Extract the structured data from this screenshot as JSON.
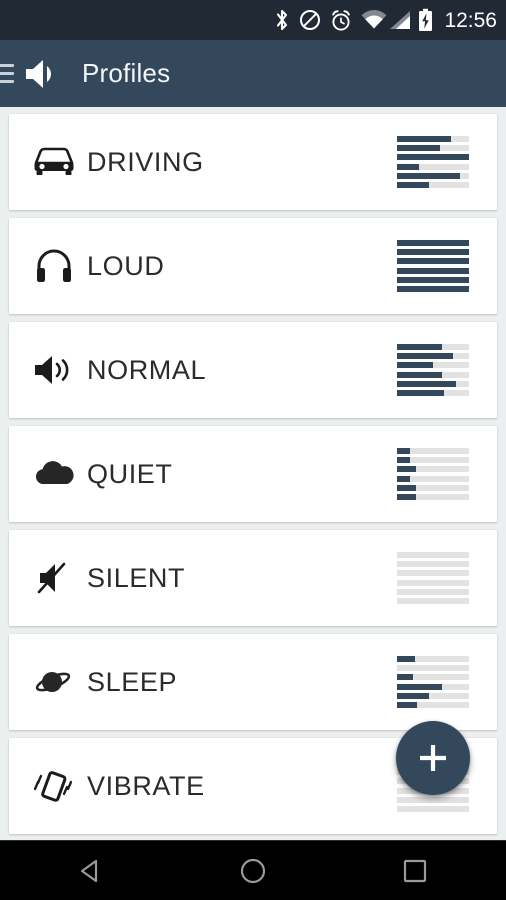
{
  "status_bar": {
    "time": "12:56",
    "background_color": "#212934",
    "icons": [
      {
        "name": "bluetooth-icon",
        "label": "Bluetooth"
      },
      {
        "name": "do-not-disturb-icon",
        "label": "Do not disturb"
      },
      {
        "name": "alarm-icon",
        "label": "Alarm set"
      },
      {
        "name": "wifi-icon",
        "label": "Wi-Fi"
      },
      {
        "name": "cellular-signal-icon",
        "label": "Cellular signal"
      },
      {
        "name": "battery-charging-icon",
        "label": "Battery charging"
      }
    ]
  },
  "app_bar": {
    "title": "Profiles",
    "background_color": "#34485c",
    "menu_icon": "hamburger-menu-icon",
    "app_icon": "speaker-icon"
  },
  "theme": {
    "accent_color": "#34485c",
    "card_background": "#ffffff",
    "page_background": "#eceff0",
    "meter_track_color": "#e2e2e2"
  },
  "profiles": [
    {
      "label": "DRIVING",
      "icon": "car-icon",
      "volumes": [
        75,
        60,
        100,
        30,
        88,
        45
      ]
    },
    {
      "label": "LOUD",
      "icon": "headphones-icon",
      "volumes": [
        100,
        100,
        100,
        100,
        100,
        100
      ]
    },
    {
      "label": "NORMAL",
      "icon": "speaker-volume-icon",
      "volumes": [
        62,
        78,
        50,
        63,
        82,
        65
      ]
    },
    {
      "label": "QUIET",
      "icon": "cloud-icon",
      "volumes": [
        18,
        18,
        26,
        18,
        26,
        26
      ]
    },
    {
      "label": "SILENT",
      "icon": "speaker-muted-icon",
      "volumes": [
        0,
        0,
        0,
        0,
        0,
        0
      ]
    },
    {
      "label": "SLEEP",
      "icon": "planet-icon",
      "volumes": [
        25,
        0,
        22,
        62,
        45,
        28
      ]
    },
    {
      "label": "VIBRATE",
      "icon": "vibrate-phone-icon",
      "volumes": [
        0,
        0,
        0,
        0,
        0,
        0
      ]
    }
  ],
  "fab": {
    "label": "+",
    "name": "add-profile-button",
    "color": "#34485c"
  },
  "nav_bar": {
    "buttons": [
      {
        "name": "nav-back-button",
        "label": "Back"
      },
      {
        "name": "nav-home-button",
        "label": "Home"
      },
      {
        "name": "nav-recents-button",
        "label": "Recents"
      }
    ]
  }
}
